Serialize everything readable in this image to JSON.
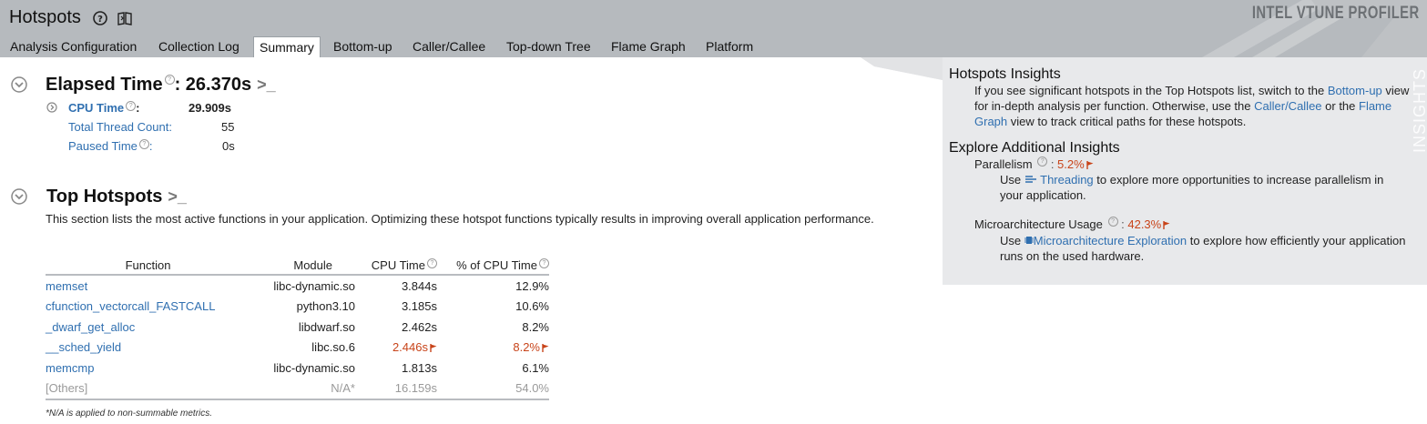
{
  "header": {
    "title": "Hotspots",
    "brand": "INTEL VTUNE PROFILER",
    "tabs": [
      {
        "label": "Analysis Configuration",
        "active": false
      },
      {
        "label": "Collection Log",
        "active": false
      },
      {
        "label": "Summary",
        "active": true
      },
      {
        "label": "Bottom-up",
        "active": false
      },
      {
        "label": "Caller/Callee",
        "active": false
      },
      {
        "label": "Top-down Tree",
        "active": false
      },
      {
        "label": "Flame Graph",
        "active": false
      },
      {
        "label": "Platform",
        "active": false
      }
    ]
  },
  "elapsed": {
    "title": "Elapsed Time",
    "value": ": 26.370s",
    "cpu_time_label": "CPU Time",
    "cpu_time_value": "29.909s",
    "thread_count_label": "Total Thread Count:",
    "thread_count_value": "55",
    "paused_label": "Paused Time",
    "paused_value": "0s"
  },
  "top_hotspots": {
    "title": "Top Hotspots",
    "description": "This section lists the most active functions in your application. Optimizing these hotspot functions typically results in improving overall application performance.",
    "columns": [
      "Function",
      "Module",
      "CPU Time",
      "% of CPU Time"
    ],
    "rows": [
      {
        "function": "memset",
        "module": "libc-dynamic.so",
        "cpu_time": "3.844s",
        "pct": "12.9%",
        "flagged": false
      },
      {
        "function": "cfunction_vectorcall_FASTCALL",
        "module": "python3.10",
        "cpu_time": "3.185s",
        "pct": "10.6%",
        "flagged": false
      },
      {
        "function": "_dwarf_get_alloc",
        "module": "libdwarf.so",
        "cpu_time": "2.462s",
        "pct": "8.2%",
        "flagged": false
      },
      {
        "function": "__sched_yield",
        "module": "libc.so.6",
        "cpu_time": "2.446s",
        "pct": "8.2%",
        "flagged": true
      },
      {
        "function": "memcmp",
        "module": "libc-dynamic.so",
        "cpu_time": "1.813s",
        "pct": "6.1%",
        "flagged": false
      }
    ],
    "others": {
      "function": "[Others]",
      "module": "N/A*",
      "cpu_time": "16.159s",
      "pct": "54.0%"
    },
    "footnote": "*N/A is applied to non-summable metrics."
  },
  "insights": {
    "side_label": "INSIGHTS",
    "hotspots_title": "Hotspots Insights",
    "hotspots_text_1": "If you see significant hotspots in the Top Hotspots list, switch to the ",
    "hotspots_link_1": "Bottom-up",
    "hotspots_text_2": " view for in-depth analysis per function. Otherwise, use the ",
    "hotspots_link_2": "Caller/Callee",
    "hotspots_text_3": " or the ",
    "hotspots_link_3": "Flame Graph",
    "hotspots_text_4": " view to track critical paths for these hotspots.",
    "explore_title": "Explore Additional Insights",
    "parallelism_label": "Parallelism",
    "parallelism_value": "5.2%",
    "parallelism_use": "Use ",
    "parallelism_link": "Threading",
    "parallelism_rest": " to explore more opportunities to increase parallelism in your application.",
    "uarch_label": "Microarchitecture Usage",
    "uarch_value": "42.3%",
    "uarch_use": "Use ",
    "uarch_link": "Microarchitecture Exploration",
    "uarch_rest": " to explore how efficiently your application runs on the used hardware."
  },
  "colors": {
    "header_bg": "#b6babe",
    "link": "#2f6fb0",
    "warning": "#c8441a",
    "insights_bg": "#e8e9eb"
  }
}
